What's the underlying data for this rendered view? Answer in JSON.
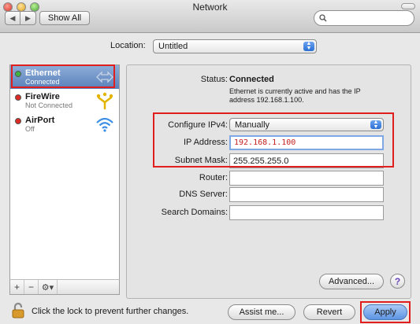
{
  "window": {
    "title": "Network"
  },
  "toolbar": {
    "show_all": "Show All"
  },
  "location": {
    "label": "Location:",
    "value": "Untitled"
  },
  "services": [
    {
      "name": "Ethernet",
      "status": "Connected",
      "indicator": "#3fb43f",
      "icon": "ethernet-icon",
      "selected": true
    },
    {
      "name": "FireWire",
      "status": "Not Connected",
      "indicator": "#dd2a24",
      "icon": "firewire-icon"
    },
    {
      "name": "AirPort",
      "status": "Off",
      "indicator": "#dd2a24",
      "icon": "wifi-icon"
    }
  ],
  "sidebar_footer": {
    "add": "+",
    "remove": "−",
    "action": "⚙▾"
  },
  "detail": {
    "status_label": "Status:",
    "status_value": "Connected",
    "status_desc": "Ethernet is currently active and has the IP address 192.168.1.100.",
    "configure_label": "Configure IPv4:",
    "configure_value": "Manually",
    "ip_label": "IP Address:",
    "ip_value": "192.168.1.100",
    "subnet_label": "Subnet Mask:",
    "subnet_value": "255.255.255.0",
    "router_label": "Router:",
    "router_value": "",
    "dns_label": "DNS Server:",
    "dns_value": "",
    "search_domains_label": "Search Domains:",
    "search_domains_value": "",
    "advanced": "Advanced...",
    "help": "?"
  },
  "footer": {
    "lock_text": "Click the lock to prevent further changes.",
    "assist": "Assist me...",
    "revert": "Revert",
    "apply": "Apply"
  },
  "colors": {
    "highlight": "#e01e1e",
    "selection": "#5a80bb",
    "ip_text": "#c62020"
  }
}
